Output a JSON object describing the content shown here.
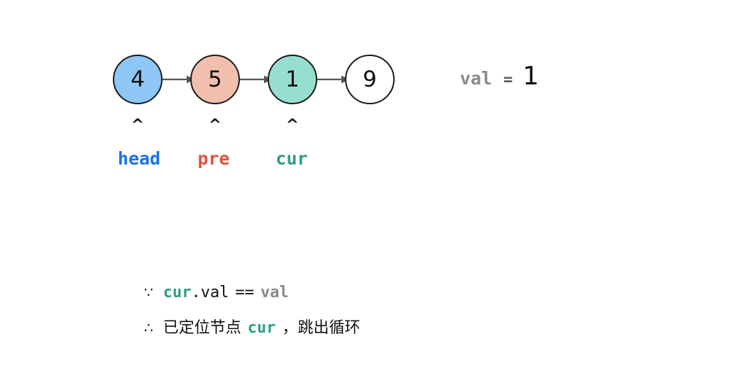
{
  "diagram": {
    "title": "linked-list-node-search",
    "nodes": [
      {
        "value": "4",
        "fill": "#8EC6F5",
        "pointer": "head",
        "pointer_color": "#1872E8",
        "caret": "^"
      },
      {
        "value": "5",
        "fill": "#F2BFAE",
        "pointer": "pre",
        "pointer_color": "#E0533C",
        "caret": "^"
      },
      {
        "value": "1",
        "fill": "#96DFD0",
        "pointer": "cur",
        "pointer_color": "#2E9E85",
        "caret": "^"
      },
      {
        "value": "9",
        "fill": "#FFFFFF",
        "pointer": "",
        "pointer_color": "",
        "caret": ""
      }
    ],
    "arrow_color": "#555555",
    "node_stroke": "#1a1a1a"
  },
  "val_expression": {
    "name": "val",
    "operator": "=",
    "value": "1",
    "name_color": "#8a8a8a",
    "value_color": "#111111"
  },
  "reasoning": {
    "line1": {
      "symbol": "∵",
      "target": "cur",
      "target_color": "#2E9E85",
      "field": ".val",
      "comparison": "==",
      "operand": "val",
      "operand_color": "#8a8a8a"
    },
    "line2": {
      "symbol": "∴",
      "text_before": "已定位节点",
      "target": "cur",
      "target_color": "#2E9E85",
      "text_after": "，跳出循环"
    }
  }
}
